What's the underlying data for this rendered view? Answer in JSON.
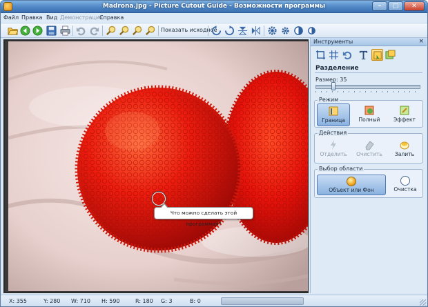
{
  "window": {
    "title": "Madrona.jpg - Picture Cutout Guide - Возможности программы",
    "buttons": [
      "minimize",
      "maximize",
      "close"
    ]
  },
  "menu": [
    "Файл",
    "Правка",
    "Вид",
    "Демонстрация",
    "Справка"
  ],
  "menu_disabled": "Демонстрация",
  "toolbar": {
    "icons": [
      "open-folder-icon",
      "back-arrow-icon",
      "forward-arrow-icon",
      "save-icon",
      "print-icon",
      "undo-icon",
      "redo-icon",
      "zoom-in-icon",
      "zoom-out-icon",
      "zoom-fit-icon",
      "zoom-actual-icon",
      "rotate-left-icon",
      "rotate-right-icon",
      "flip-vertical-icon",
      "flip-horizontal-icon",
      "settings-icon",
      "adjust-icon",
      "contrast-icon",
      "brightness-icon"
    ],
    "show_original_label": "Показать исходное"
  },
  "canvas": {
    "tooltip": "Что можно сделать этой программой?"
  },
  "panel": {
    "title": "Инструменты",
    "close_glyph": "×",
    "tools": [
      "crop-icon",
      "grid-icon",
      "undo-tool-icon",
      "text-tool-icon",
      "cutout-tool-icon",
      "background-tool-icon"
    ],
    "active_tool": "cutout-tool-icon",
    "section_title": "Разделение",
    "size_label": "Размер: 35",
    "size_value": 35,
    "mode": {
      "label": "Режим",
      "buttons": [
        {
          "label": "Граница",
          "icon": "border-brush-icon",
          "active": true
        },
        {
          "label": "Полный",
          "icon": "full-brush-icon",
          "active": false
        },
        {
          "label": "Эффект",
          "icon": "effect-brush-icon",
          "active": false
        }
      ]
    },
    "actions": {
      "label": "Действия",
      "buttons": [
        {
          "label": "Отделить",
          "icon": "separate-icon",
          "enabled": false
        },
        {
          "label": "Очистить",
          "icon": "eraser-icon",
          "enabled": false
        },
        {
          "label": "Залить",
          "icon": "fill-icon",
          "enabled": true
        }
      ]
    },
    "selection": {
      "label": "Выбор области",
      "object_label": "Объект или Фон",
      "clear_label": "Очистка"
    }
  },
  "status": {
    "x": "X: 355",
    "y": "Y: 280",
    "w": "W: 710",
    "h": "H: 590",
    "r": "R: 180",
    "g": "G: 3",
    "b": "B: 0"
  },
  "colors": {
    "accent": "#4f86c4",
    "berry_red": "#e8140c",
    "panel_bg": "#dfeaf7"
  }
}
